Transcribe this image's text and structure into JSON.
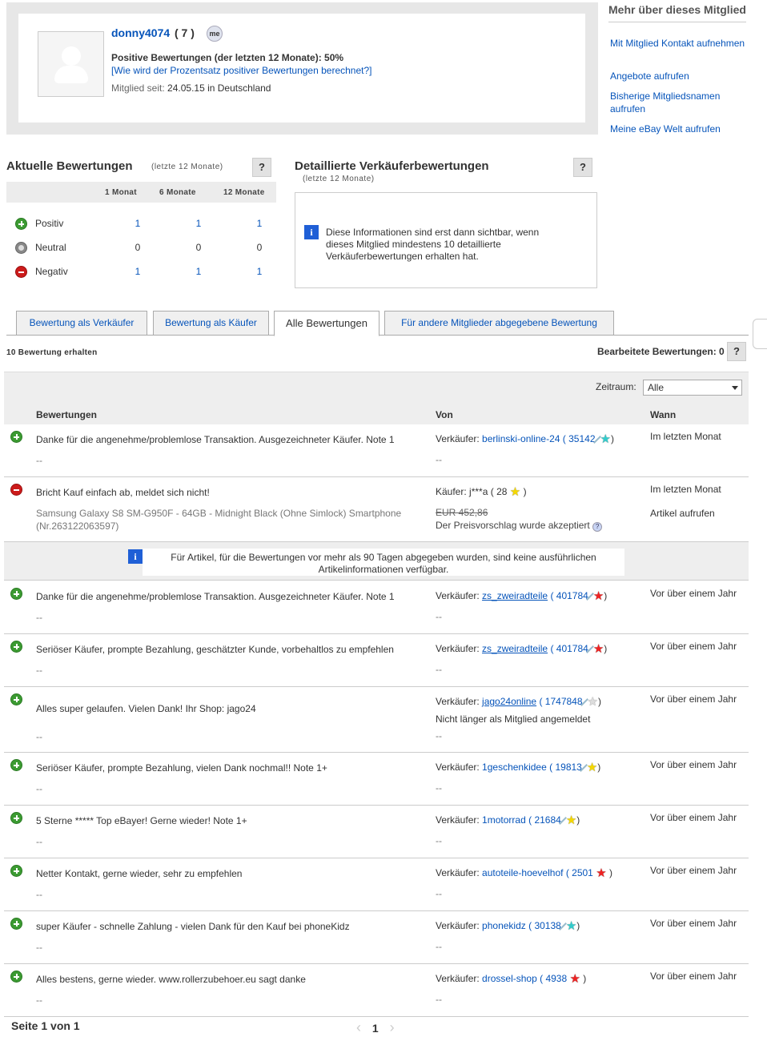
{
  "profile": {
    "username": "donny4074",
    "score": "( 7 )",
    "positive_label": "Positive Bewertungen (der letzten 12 Monate): 50%",
    "calc_link": "[Wie wird der Prozentsatz positiver Bewertungen berechnet?]",
    "member_since_label": "Mitglied seit:",
    "member_since_value": "24.05.15 in Deutschland"
  },
  "sidebar": {
    "title": "Mehr über dieses Mitglied",
    "links": [
      "Mit Mitglied Kontakt aufnehmen",
      "Angebote aufrufen",
      "Bisherige Mitgliedsnamen aufrufen",
      "Meine eBay Welt aufrufen"
    ]
  },
  "current": {
    "title": "Aktuelle Bewertungen",
    "subtitle": "(letzte 12 Monate)",
    "help": "?",
    "columns": [
      "1 Monat",
      "6 Monate",
      "12 Monate"
    ],
    "rows": [
      {
        "label": "Positiv",
        "values": [
          "1",
          "1",
          "1"
        ],
        "link": true
      },
      {
        "label": "Neutral",
        "values": [
          "0",
          "0",
          "0"
        ],
        "link": false
      },
      {
        "label": "Negativ",
        "values": [
          "1",
          "1",
          "1"
        ],
        "link": true
      }
    ]
  },
  "detailed": {
    "title": "Detaillierte Verkäuferbewertungen",
    "subtitle": "(letzte 12 Monate)",
    "help": "?",
    "info_icon": "i",
    "info": "Diese Informationen sind erst dann sichtbar, wenn dieses Mitglied mindestens 10 detaillierte Verkäuferbewertungen erhalten hat."
  },
  "tabs": [
    "Bewertung als Verkäufer",
    "Bewertung als Käufer",
    "Alle Bewertungen",
    "Für andere Mitglieder abgegebene Bewertung"
  ],
  "summary": {
    "received": "10 Bewertung erhalten",
    "edited": "Bearbeitete Bewertungen: 0",
    "help": "?"
  },
  "filter": {
    "label": "Zeitraum:",
    "value": "Alle"
  },
  "table": {
    "headers": [
      "Bewertungen",
      "Von",
      "Wann"
    ]
  },
  "feedback": [
    {
      "type": "positive",
      "text": "Danke für die angenehme/problemlose Transaktion. Ausgezeichneter Käufer. Note 1",
      "sub": "--",
      "role": "Verkäufer:",
      "user": "berlinski-online-24",
      "score": "35142",
      "star": "#3cc",
      "shooting": true,
      "when": "Im letzten Monat"
    },
    {
      "type": "negative",
      "text": "Bricht Kauf einfach ab, meldet sich nicht!",
      "sub": "Samsung Galaxy S8 SM-G950F - 64GB - Midnight Black (Ohne Simlock) Smartphone (Nr.263122063597)",
      "role": "Käufer:",
      "user": "j***a",
      "score": "28",
      "star": "#f5d800",
      "shooting": false,
      "price": "EUR 452,86",
      "price_note": "Der Preisvorschlag wurde akzeptiert",
      "when": "Im letzten Monat",
      "item_link": "Artikel aufrufen"
    },
    {
      "type": "positive",
      "text": "Danke für die angenehme/problemlose Transaktion. Ausgezeichneter Käufer. Note 1",
      "sub": "--",
      "role": "Verkäufer:",
      "user": "zs_zweiradteile",
      "score": "401784",
      "star": "#e22",
      "shooting": true,
      "when": "Vor über einem Jahr"
    },
    {
      "type": "positive",
      "text": "Seriöser Käufer, prompte Bezahlung, geschätzter Kunde, vorbehaltlos zu empfehlen",
      "sub": "--",
      "role": "Verkäufer:",
      "user": "zs_zweiradteile",
      "score": "401784",
      "star": "#e22",
      "shooting": true,
      "when": "Vor über einem Jahr"
    },
    {
      "type": "positive",
      "text": "Alles super gelaufen. Vielen Dank! Ihr Shop: jago24",
      "sub": "--",
      "role": "Verkäufer:",
      "user": "jago24online",
      "score": "1747848",
      "star": "#ddd",
      "shooting": true,
      "note": "Nicht länger als Mitglied angemeldet",
      "when": "Vor über einem Jahr"
    },
    {
      "type": "positive",
      "text": "Seriöser Käufer, prompte Bezahlung, vielen Dank nochmal!! Note 1+",
      "sub": "--",
      "role": "Verkäufer:",
      "user": "1geschenkidee",
      "score": "19813",
      "star": "#f5d800",
      "shooting": true,
      "when": "Vor über einem Jahr"
    },
    {
      "type": "positive",
      "text": "5 Sterne ***** Top eBayer! Gerne wieder! Note 1+",
      "sub": "--",
      "role": "Verkäufer:",
      "user": "1motorrad",
      "score": "21684",
      "star": "#f5d800",
      "shooting": true,
      "when": "Vor über einem Jahr"
    },
    {
      "type": "positive",
      "text": "Netter Kontakt, gerne wieder, sehr zu empfehlen",
      "sub": "--",
      "role": "Verkäufer:",
      "user": "autoteile-hoevelhof",
      "score": "2501",
      "star": "#e22",
      "shooting": false,
      "when": "Vor über einem Jahr"
    },
    {
      "type": "positive",
      "text": "super Käufer - schnelle Zahlung - vielen Dank für den Kauf bei phoneKidz",
      "sub": "--",
      "role": "Verkäufer:",
      "user": "phonekidz",
      "score": "30138",
      "star": "#3cc",
      "shooting": true,
      "when": "Vor über einem Jahr"
    },
    {
      "type": "positive",
      "text": "Alles bestens, gerne wieder. www.rollerzubehoer.eu sagt danke",
      "sub": "--",
      "role": "Verkäufer:",
      "user": "drossel-shop",
      "score": "4938",
      "star": "#e22",
      "shooting": false,
      "when": "Vor über einem Jahr"
    }
  ],
  "notice": {
    "icon": "i",
    "text": "Für Artikel, für die Bewertungen vor mehr als 90 Tagen abgegeben wurden, sind keine ausführlichen Artikelinformationen verfügbar."
  },
  "pager": {
    "text": "Seite 1 von 1",
    "current": "1",
    "prev": "‹",
    "next": "›"
  }
}
